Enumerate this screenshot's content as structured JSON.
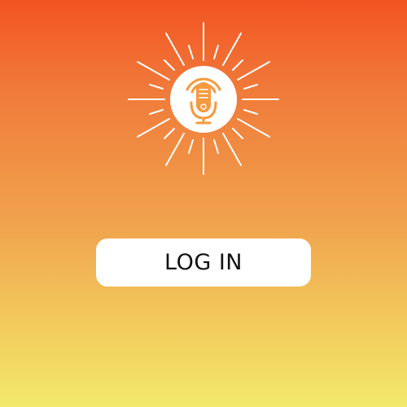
{
  "login_button": {
    "label": "LOG IN"
  },
  "logo": {
    "icon": "podcast-microphone-sunburst-icon",
    "mic_icon": "microphone-icon"
  },
  "colors": {
    "gradient_top": "#F35322",
    "gradient_bottom": "#F2E96C",
    "accent_orange": "#F59A3E",
    "white": "#FFFFFF",
    "button_text": "#111111"
  }
}
